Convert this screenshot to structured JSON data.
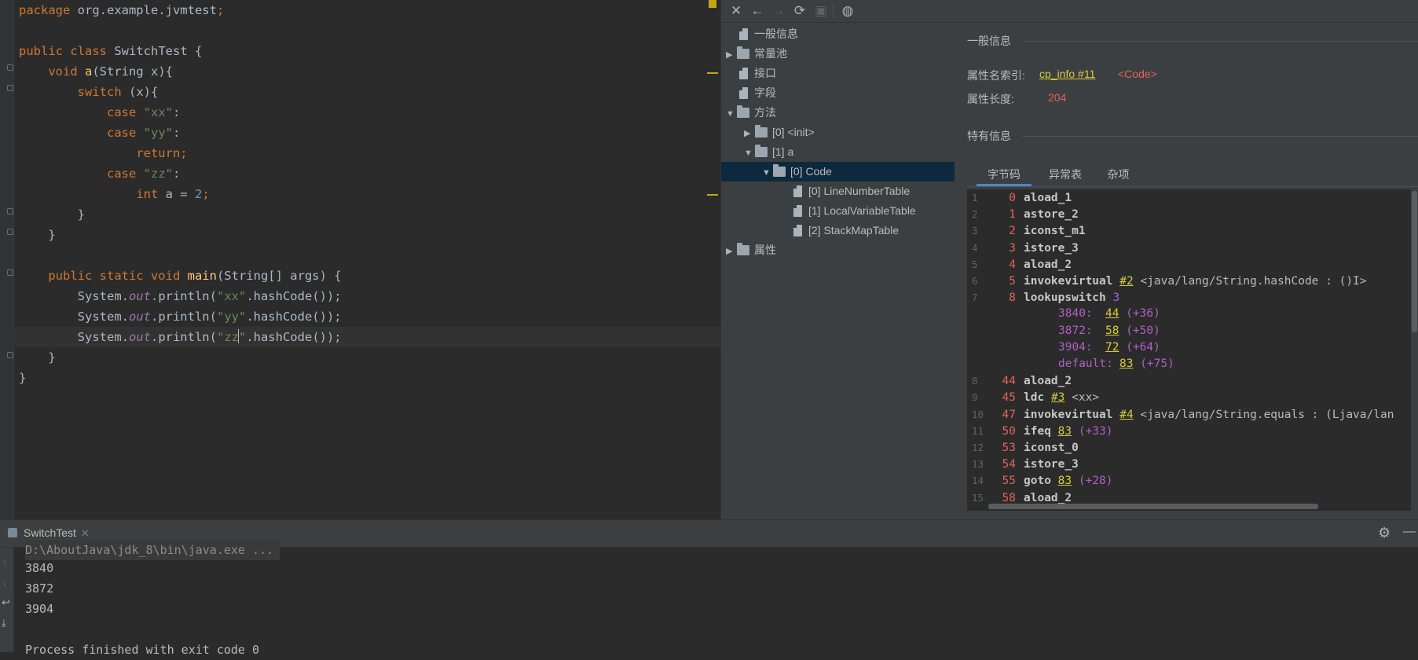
{
  "editor": {
    "lines": [
      {
        "parts": [
          [
            "kw",
            "package "
          ],
          [
            "fnm",
            "org.example.jvmtest"
          ],
          [
            "kw",
            ";"
          ]
        ]
      },
      {
        "parts": []
      },
      {
        "parts": [
          [
            "kw",
            "public class "
          ],
          [
            "fnm",
            "SwitchTest {"
          ]
        ]
      },
      {
        "parts": [
          [
            "fnm",
            "    "
          ],
          [
            "kw",
            "void "
          ],
          [
            "fn",
            "a"
          ],
          [
            "fnm",
            "(String x){"
          ]
        ]
      },
      {
        "parts": [
          [
            "fnm",
            "        "
          ],
          [
            "kw",
            "switch "
          ],
          [
            "fnm",
            "(x){"
          ]
        ]
      },
      {
        "parts": [
          [
            "fnm",
            "            "
          ],
          [
            "kw",
            "case "
          ],
          [
            "str",
            "\"xx\""
          ],
          [
            "fnm",
            ":"
          ]
        ]
      },
      {
        "parts": [
          [
            "fnm",
            "            "
          ],
          [
            "kw",
            "case "
          ],
          [
            "str",
            "\"yy\""
          ],
          [
            "fnm",
            ":"
          ]
        ]
      },
      {
        "parts": [
          [
            "fnm",
            "                "
          ],
          [
            "kw",
            "return;"
          ]
        ]
      },
      {
        "parts": [
          [
            "fnm",
            "            "
          ],
          [
            "kw",
            "case "
          ],
          [
            "str",
            "\"zz\""
          ],
          [
            "fnm",
            ":"
          ]
        ]
      },
      {
        "parts": [
          [
            "fnm",
            "                "
          ],
          [
            "kw",
            "int "
          ],
          [
            "fnm",
            "a = "
          ],
          [
            "num",
            "2"
          ],
          [
            "kw",
            ";"
          ]
        ]
      },
      {
        "parts": [
          [
            "fnm",
            "        }"
          ]
        ]
      },
      {
        "parts": [
          [
            "fnm",
            "    }"
          ]
        ]
      },
      {
        "parts": []
      },
      {
        "parts": [
          [
            "fnm",
            "    "
          ],
          [
            "kw",
            "public static void "
          ],
          [
            "fn",
            "main"
          ],
          [
            "fnm",
            "(String[] args) {"
          ]
        ]
      },
      {
        "parts": [
          [
            "fnm",
            "        System."
          ],
          [
            "fld",
            "out"
          ],
          [
            "fnm",
            ".println("
          ],
          [
            "str",
            "\"xx\""
          ],
          [
            "fnm",
            ".hashCode());"
          ]
        ]
      },
      {
        "parts": [
          [
            "fnm",
            "        System."
          ],
          [
            "fld",
            "out"
          ],
          [
            "fnm",
            ".println("
          ],
          [
            "str",
            "\"yy\""
          ],
          [
            "fnm",
            ".hashCode());"
          ]
        ]
      },
      {
        "parts": [
          [
            "fnm",
            "        System."
          ],
          [
            "fld",
            "out"
          ],
          [
            "fnm",
            ".println("
          ],
          [
            "str",
            "\"zz"
          ],
          [
            "caret",
            ""
          ],
          [
            "str",
            "\""
          ],
          [
            "fnm",
            ".hashCode());"
          ]
        ]
      },
      {
        "parts": [
          [
            "fnm",
            "    }"
          ]
        ]
      },
      {
        "parts": [
          [
            "fnm",
            "}"
          ]
        ]
      }
    ]
  },
  "viewer": {
    "toolbar": {
      "close_icon": "✕",
      "back_icon": "←",
      "forward_icon": "→",
      "refresh_icon": "⟳",
      "save_icon": "▣",
      "web_icon": "◍"
    },
    "tree": [
      {
        "label": "一般信息",
        "type": "file",
        "arrow": "",
        "indent": 0
      },
      {
        "label": "常量池",
        "type": "folder",
        "arrow": "▶",
        "indent": 0
      },
      {
        "label": "接口",
        "type": "file",
        "arrow": "",
        "indent": 0
      },
      {
        "label": "字段",
        "type": "file",
        "arrow": "",
        "indent": 0
      },
      {
        "label": "方法",
        "type": "folder",
        "arrow": "▼",
        "indent": 0
      },
      {
        "label": "[0] <init>",
        "type": "folder",
        "arrow": "▶",
        "indent": 1
      },
      {
        "label": "[1] a",
        "type": "folder",
        "arrow": "▼",
        "indent": 1
      },
      {
        "label": "[0] Code",
        "type": "folder",
        "arrow": "▼",
        "indent": 2,
        "selected": true
      },
      {
        "label": "[0] LineNumberTable",
        "type": "file",
        "arrow": "",
        "indent": 3
      },
      {
        "label": "[1] LocalVariableTable",
        "type": "file",
        "arrow": "",
        "indent": 3
      },
      {
        "label": "[2] StackMapTable",
        "type": "file",
        "arrow": "",
        "indent": 3
      },
      {
        "label": "属性",
        "type": "folder",
        "arrow": "▶",
        "indent": 0
      }
    ],
    "general_title": "一般信息",
    "attr_name_label": "属性名索引:",
    "attr_name_link": "cp_info #11",
    "attr_name_value": "<Code>",
    "attr_len_label": "属性长度:",
    "attr_len_value": "204",
    "specific_title": "特有信息",
    "tabs": [
      "字节码",
      "异常表",
      "杂项"
    ],
    "bytecode": [
      {
        "ln": "1",
        "off": "0",
        "op": "aload_1"
      },
      {
        "ln": "2",
        "off": "1",
        "op": "astore_2"
      },
      {
        "ln": "3",
        "off": "2",
        "op": "iconst_m1"
      },
      {
        "ln": "4",
        "off": "3",
        "op": "istore_3"
      },
      {
        "ln": "5",
        "off": "4",
        "op": "aload_2"
      },
      {
        "ln": "6",
        "off": "5",
        "op": "invokevirtual",
        "ref": "#2",
        "arg": " <java/lang/String.hashCode : ()I>"
      },
      {
        "ln": "7",
        "off": "8",
        "op": "lookupswitch",
        "pur": " 3"
      },
      {
        "ln": "",
        "off": "",
        "sw": "3840:",
        "ref": "44",
        "pur": " (+36)"
      },
      {
        "ln": "",
        "off": "",
        "sw": "3872:",
        "ref": "58",
        "pur": " (+50)"
      },
      {
        "ln": "",
        "off": "",
        "sw": "3904:",
        "ref": "72",
        "pur": " (+64)"
      },
      {
        "ln": "",
        "off": "",
        "sw": "default:",
        "ref": "83",
        "pur": " (+75)"
      },
      {
        "ln": "8",
        "off": "44",
        "op": "aload_2"
      },
      {
        "ln": "9",
        "off": "45",
        "op": "ldc",
        "ref": "#3",
        "arg": " <xx>"
      },
      {
        "ln": "10",
        "off": "47",
        "op": "invokevirtual",
        "ref": "#4",
        "arg": " <java/lang/String.equals : (Ljava/lan"
      },
      {
        "ln": "11",
        "off": "50",
        "op": "ifeq",
        "ref": "83",
        "pur": " (+33)"
      },
      {
        "ln": "12",
        "off": "53",
        "op": "iconst_0"
      },
      {
        "ln": "13",
        "off": "54",
        "op": "istore_3"
      },
      {
        "ln": "14",
        "off": "55",
        "op": "goto",
        "ref": "83",
        "pur": " (+28)"
      },
      {
        "ln": "15",
        "off": "58",
        "op": "aload_2"
      }
    ]
  },
  "run": {
    "tab_label": "SwitchTest",
    "tab_close": "✕",
    "command": "D:\\AboutJava\\jdk_8\\bin\\java.exe ...",
    "output": [
      "3840",
      "3872",
      "3904",
      "",
      "Process finished with exit code 0"
    ],
    "settings_icon": "⚙",
    "minimize_icon": "—"
  }
}
